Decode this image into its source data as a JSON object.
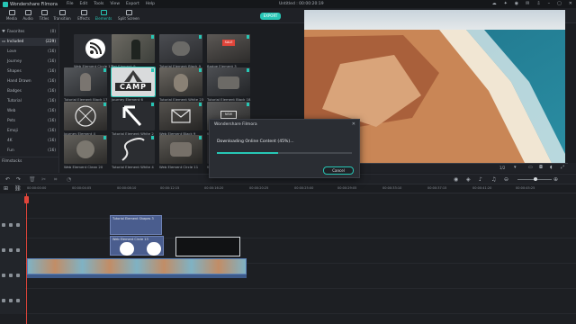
{
  "titlebar": {
    "app_name": "Wondershare Filmora",
    "menu": [
      "File",
      "Edit",
      "Tools",
      "View",
      "Export",
      "Help"
    ],
    "document": "Untitled : 00:00:20:19"
  },
  "toolbar": {
    "tabs": [
      {
        "label": "Media",
        "icon": "media-icon"
      },
      {
        "label": "Audio",
        "icon": "music-note-icon"
      },
      {
        "label": "Titles",
        "icon": "text-icon"
      },
      {
        "label": "Transition",
        "icon": "transition-icon"
      },
      {
        "label": "Effects",
        "icon": "effects-icon"
      },
      {
        "label": "Elements",
        "icon": "elements-icon"
      },
      {
        "label": "Split Screen",
        "icon": "split-screen-icon"
      }
    ],
    "active_tab": "Elements",
    "export_label": "EXPORT"
  },
  "sidebar": {
    "items": [
      {
        "label": "Favorites",
        "count": "(0)"
      },
      {
        "label": "Included",
        "count": "(229)"
      },
      {
        "label": "Love",
        "count": "(16)"
      },
      {
        "label": "Journey",
        "count": "(16)"
      },
      {
        "label": "Shapes",
        "count": "(16)"
      },
      {
        "label": "Hand Drawn",
        "count": "(16)"
      },
      {
        "label": "Badges",
        "count": "(16)"
      },
      {
        "label": "Tutorial",
        "count": "(16)"
      },
      {
        "label": "Web",
        "count": "(16)"
      },
      {
        "label": "Pets",
        "count": "(16)"
      },
      {
        "label": "Emoji",
        "count": "(16)"
      },
      {
        "label": "4K",
        "count": "(16)"
      },
      {
        "label": "Fun",
        "count": "(16)"
      }
    ],
    "filmstocks": "Filmstocks"
  },
  "search": {
    "placeholder": "Search"
  },
  "library": {
    "items": [
      {
        "caption": "Web Element Circle 13",
        "thumb": "rss"
      },
      {
        "caption": "Pet Element 9",
        "thumb": "photo-b"
      },
      {
        "caption": "Tutorial Element Black 9",
        "thumb": "photo-a"
      },
      {
        "caption": "Badge Element 3",
        "thumb": "badge"
      },
      {
        "caption": "Tutorial Element Black 17",
        "thumb": "photo-c"
      },
      {
        "caption": "Journey Element 6",
        "thumb": "camp"
      },
      {
        "caption": "Tutorial Element White 23",
        "thumb": "photo-b"
      },
      {
        "caption": "Tutorial Element Black 18",
        "thumb": "photo-a"
      },
      {
        "caption": "Journey Element 4",
        "thumb": "compass"
      },
      {
        "caption": "Tutorial Element White 2",
        "thumb": "arrow"
      },
      {
        "caption": "Web Element Black 9",
        "thumb": "mail"
      },
      {
        "caption": "Web Element Black 2",
        "thumb": "photo-c"
      },
      {
        "caption": "Web Element Clean 20",
        "thumb": "photo-a"
      },
      {
        "caption": "Tutorial Element White 4",
        "thumb": "road"
      },
      {
        "caption": "Web Element Circle 11",
        "thumb": "photo-b"
      },
      {
        "caption": "Web Element Circle 5",
        "thumb": "star"
      }
    ],
    "camp_text": "CAMP",
    "badge_text": "SALE",
    "mail_text": "NEW"
  },
  "preview": {
    "page_indicator": "1/2",
    "bar_icons": [
      "play-icon",
      "snapshot-icon",
      "volume-icon",
      "fullscreen-icon"
    ]
  },
  "timeline": {
    "ruler_ticks": [
      "00:00:00:00",
      "00:00:04:05",
      "00:00:08:10",
      "00:00:12:15",
      "00:00:16:20",
      "00:00:20:25",
      "00:00:25:00",
      "00:00:29:05",
      "00:00:33:10",
      "00:00:37:15",
      "00:00:41:20",
      "00:00:45:25"
    ],
    "clips": {
      "element_clip_label": "Tutorial Element Shapes 3",
      "video_clip_label": "Web Element Circle 13"
    }
  },
  "dialog": {
    "title": "Wondershare Filmora",
    "message": "Downloading Online Content (45%)...",
    "progress": 0.45,
    "cancel_label": "Cancel"
  },
  "colors": {
    "accent": "#27c6b5",
    "badge_red": "#e0453a"
  }
}
